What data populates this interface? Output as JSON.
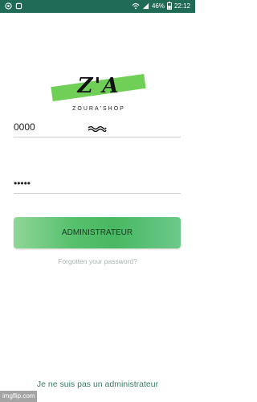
{
  "status_bar": {
    "battery_percent": "46%",
    "time": "22:12",
    "icons": [
      "whatsapp-icon",
      "notification-icon",
      "wifi-icon",
      "signal-icon",
      "battery-icon"
    ]
  },
  "logo": {
    "mark": "Z'A",
    "text": "ZOURA'SHOP",
    "accent_color": "#6fcf57"
  },
  "form": {
    "username_value": "0000",
    "password_value": "•••••"
  },
  "admin_button": {
    "label": "ADMINISTRATEUR"
  },
  "forgot_link": "Forgotten your password?",
  "not_admin_link": "Je ne suis pas un administrateur",
  "watermark": "imgflip.com",
  "colors": {
    "status_bar": "#1f6b55",
    "button_green": "#48b862"
  }
}
